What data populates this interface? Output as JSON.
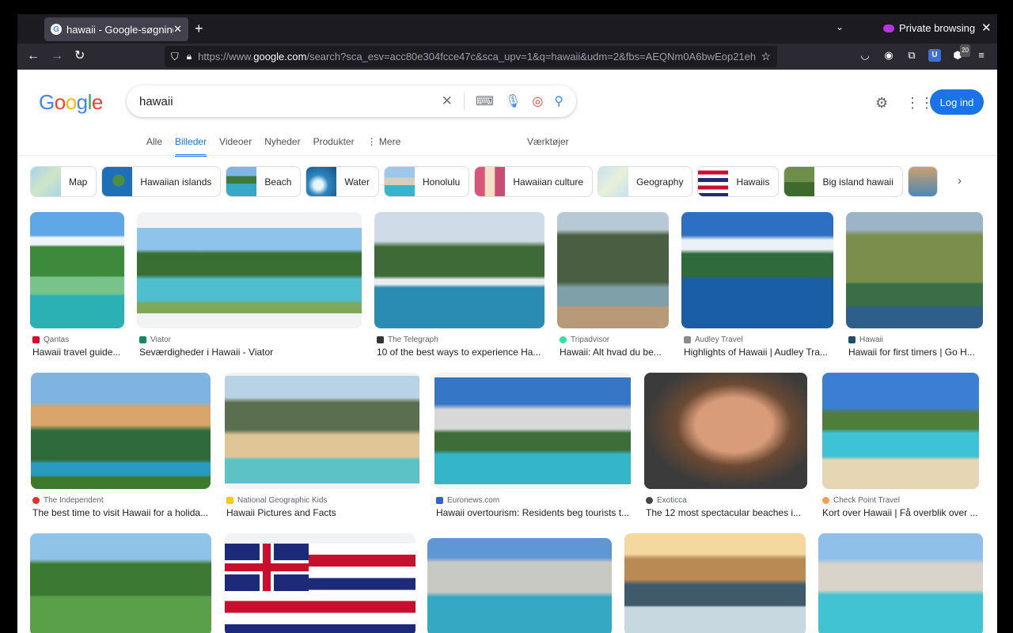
{
  "browser": {
    "tab_title": "hawaii - Google-søgning",
    "favicon": "G",
    "private_label": "Private browsing",
    "url_prefix": "https://www.",
    "url_domain": "google.com",
    "url_rest": "/search?sca_esv=acc80e304fcce47c&sca_upv=1&q=hawaii&udm=2&fbs=AEQNm0A6bwEop21ehxKWq5cjEGqp...",
    "extension_badge": "20"
  },
  "google": {
    "logo": [
      "G",
      "o",
      "o",
      "g",
      "l",
      "e"
    ],
    "logo_colors": [
      "#4285f4",
      "#ea4335",
      "#fbbc05",
      "#4285f4",
      "#34a853",
      "#ea4335"
    ],
    "query": "hawaii",
    "login_label": "Log ind",
    "tabs": [
      "Alle",
      "Billeder",
      "Videoer",
      "Nyheder",
      "Produkter",
      "⋮ Mere"
    ],
    "active_tab": "Billeder",
    "tools_label": "Værktøjer"
  },
  "chips": [
    "Map",
    "Hawaiian islands",
    "Beach",
    "Water",
    "Honolulu",
    "Hawaiian culture",
    "Geography",
    "Hawaiis",
    "Big island hawaii"
  ],
  "results": [
    {
      "source": "Qantas",
      "title": "Hawaii travel guide..."
    },
    {
      "source": "Viator",
      "title": "Seværdigheder i Hawaii - Viator"
    },
    {
      "source": "The Telegraph",
      "title": "10 of the best ways to experience Ha..."
    },
    {
      "source": "Tripadvisor",
      "title": "Hawaii: Alt hvad du be..."
    },
    {
      "source": "Audley Travel",
      "title": "Highlights of Hawaii | Audley Tra..."
    },
    {
      "source": "Hawaii",
      "title": "Hawaii for first timers | Go H..."
    },
    {
      "source": "The Independent",
      "title": "The best time to visit Hawaii for a holida..."
    },
    {
      "source": "National Geographic Kids",
      "title": "Hawaii Pictures and Facts"
    },
    {
      "source": "Euronews.com",
      "title": "Hawaii overtourism: Residents beg tourists t..."
    },
    {
      "source": "Exoticca",
      "title": "The 12 most spectacular beaches i..."
    },
    {
      "source": "Check Point Travel",
      "title": "Kort over Hawaii | Få overblik over ..."
    }
  ],
  "colors": {
    "accent": "#1a73e8",
    "tabbar": "#1c1b22",
    "navbar": "#2b2a33"
  }
}
